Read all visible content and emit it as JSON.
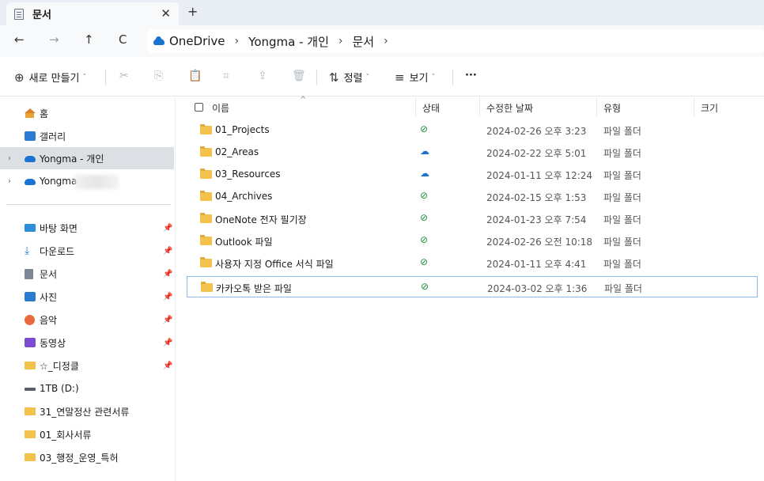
{
  "tab": {
    "title": "문서",
    "close": "✕",
    "add": "+"
  },
  "nav": {
    "back": "←",
    "forward": "→",
    "up": "↑",
    "refresh": "C"
  },
  "breadcrumb": {
    "items": [
      "OneDrive",
      "Yongma - 개인",
      "문서"
    ],
    "sep": "›",
    "trailing": "›"
  },
  "toolbar": {
    "new_icon": "⊕",
    "new_label": "새로 만들기",
    "caret": "˅",
    "cut": "✂",
    "copy": "⎘",
    "paste": "📋",
    "rename": "⌗",
    "share": "⇪",
    "delete": "🗑",
    "sort_icon": "⇅",
    "sort_label": "정렬",
    "view_icon": "≡",
    "view_label": "보기",
    "more": "···"
  },
  "sidebar": {
    "items": [
      {
        "label": "홈",
        "icon": "home-icon"
      },
      {
        "label": "갤러리",
        "icon": "gallery-icon"
      },
      {
        "label": "Yongma - 개인",
        "icon": "cloud-icon",
        "chevron": "›"
      },
      {
        "label": "Yongma",
        "icon": "cloud-icon",
        "chevron": "›"
      },
      {
        "label": "바탕 화면",
        "icon": "desktop-icon",
        "pin": "📌"
      },
      {
        "label": "다운로드",
        "icon": "download-icon",
        "pin": "📌"
      },
      {
        "label": "문서",
        "icon": "document-icon",
        "pin": "📌"
      },
      {
        "label": "사진",
        "icon": "pictures-icon",
        "pin": "📌"
      },
      {
        "label": "음악",
        "icon": "music-icon",
        "pin": "📌"
      },
      {
        "label": "동영상",
        "icon": "video-icon",
        "pin": "📌"
      },
      {
        "label": "☆_디정클",
        "icon": "folder-icon",
        "pin": "📌"
      },
      {
        "label": "1TB (D:)",
        "icon": "drive-icon"
      },
      {
        "label": "31_연말정산 관련서류",
        "icon": "folder-icon"
      },
      {
        "label": "01_회사서류",
        "icon": "folder-icon"
      },
      {
        "label": "03_행정_운영_특허",
        "icon": "folder-icon"
      }
    ],
    "download_glyph": "⤓"
  },
  "columns": {
    "name": "이름",
    "status": "상태",
    "modified": "수정한 날짜",
    "type": "유형",
    "size": "크기",
    "sort_caret": "^"
  },
  "files": [
    {
      "name": "01_Projects",
      "status": "ok",
      "status_glyph": "⊘",
      "date": "2024-02-26 오후 3:23",
      "type": "파일 폴더"
    },
    {
      "name": "02_Areas",
      "status": "cloud",
      "status_glyph": "☁",
      "date": "2024-02-22 오후 5:01",
      "type": "파일 폴더"
    },
    {
      "name": "03_Resources",
      "status": "cloud",
      "status_glyph": "☁",
      "date": "2024-01-11 오후 12:24",
      "type": "파일 폴더"
    },
    {
      "name": "04_Archives",
      "status": "ok",
      "status_glyph": "⊘",
      "date": "2024-02-15 오후 1:53",
      "type": "파일 폴더"
    },
    {
      "name": "OneNote 전자 필기장",
      "status": "ok",
      "status_glyph": "⊘",
      "date": "2024-01-23 오후 7:54",
      "type": "파일 폴더"
    },
    {
      "name": "Outlook 파일",
      "status": "ok",
      "status_glyph": "⊘",
      "date": "2024-02-26 오전 10:18",
      "type": "파일 폴더"
    },
    {
      "name": "사용자 지정 Office 서식 파일",
      "status": "ok",
      "status_glyph": "⊘",
      "date": "2024-01-11 오후 4:41",
      "type": "파일 폴더"
    },
    {
      "name": "카카오톡 받은 파일",
      "status": "ok",
      "status_glyph": "⊘",
      "date": "2024-03-02 오후 1:36",
      "type": "파일 폴더"
    }
  ],
  "colors": {
    "accent": "#1a73d1",
    "ok": "#1d8a3a",
    "folder": "#f2c24c",
    "selected_row_border": "#8fb7e8",
    "sidebar_selected": "#dcdfe3"
  }
}
